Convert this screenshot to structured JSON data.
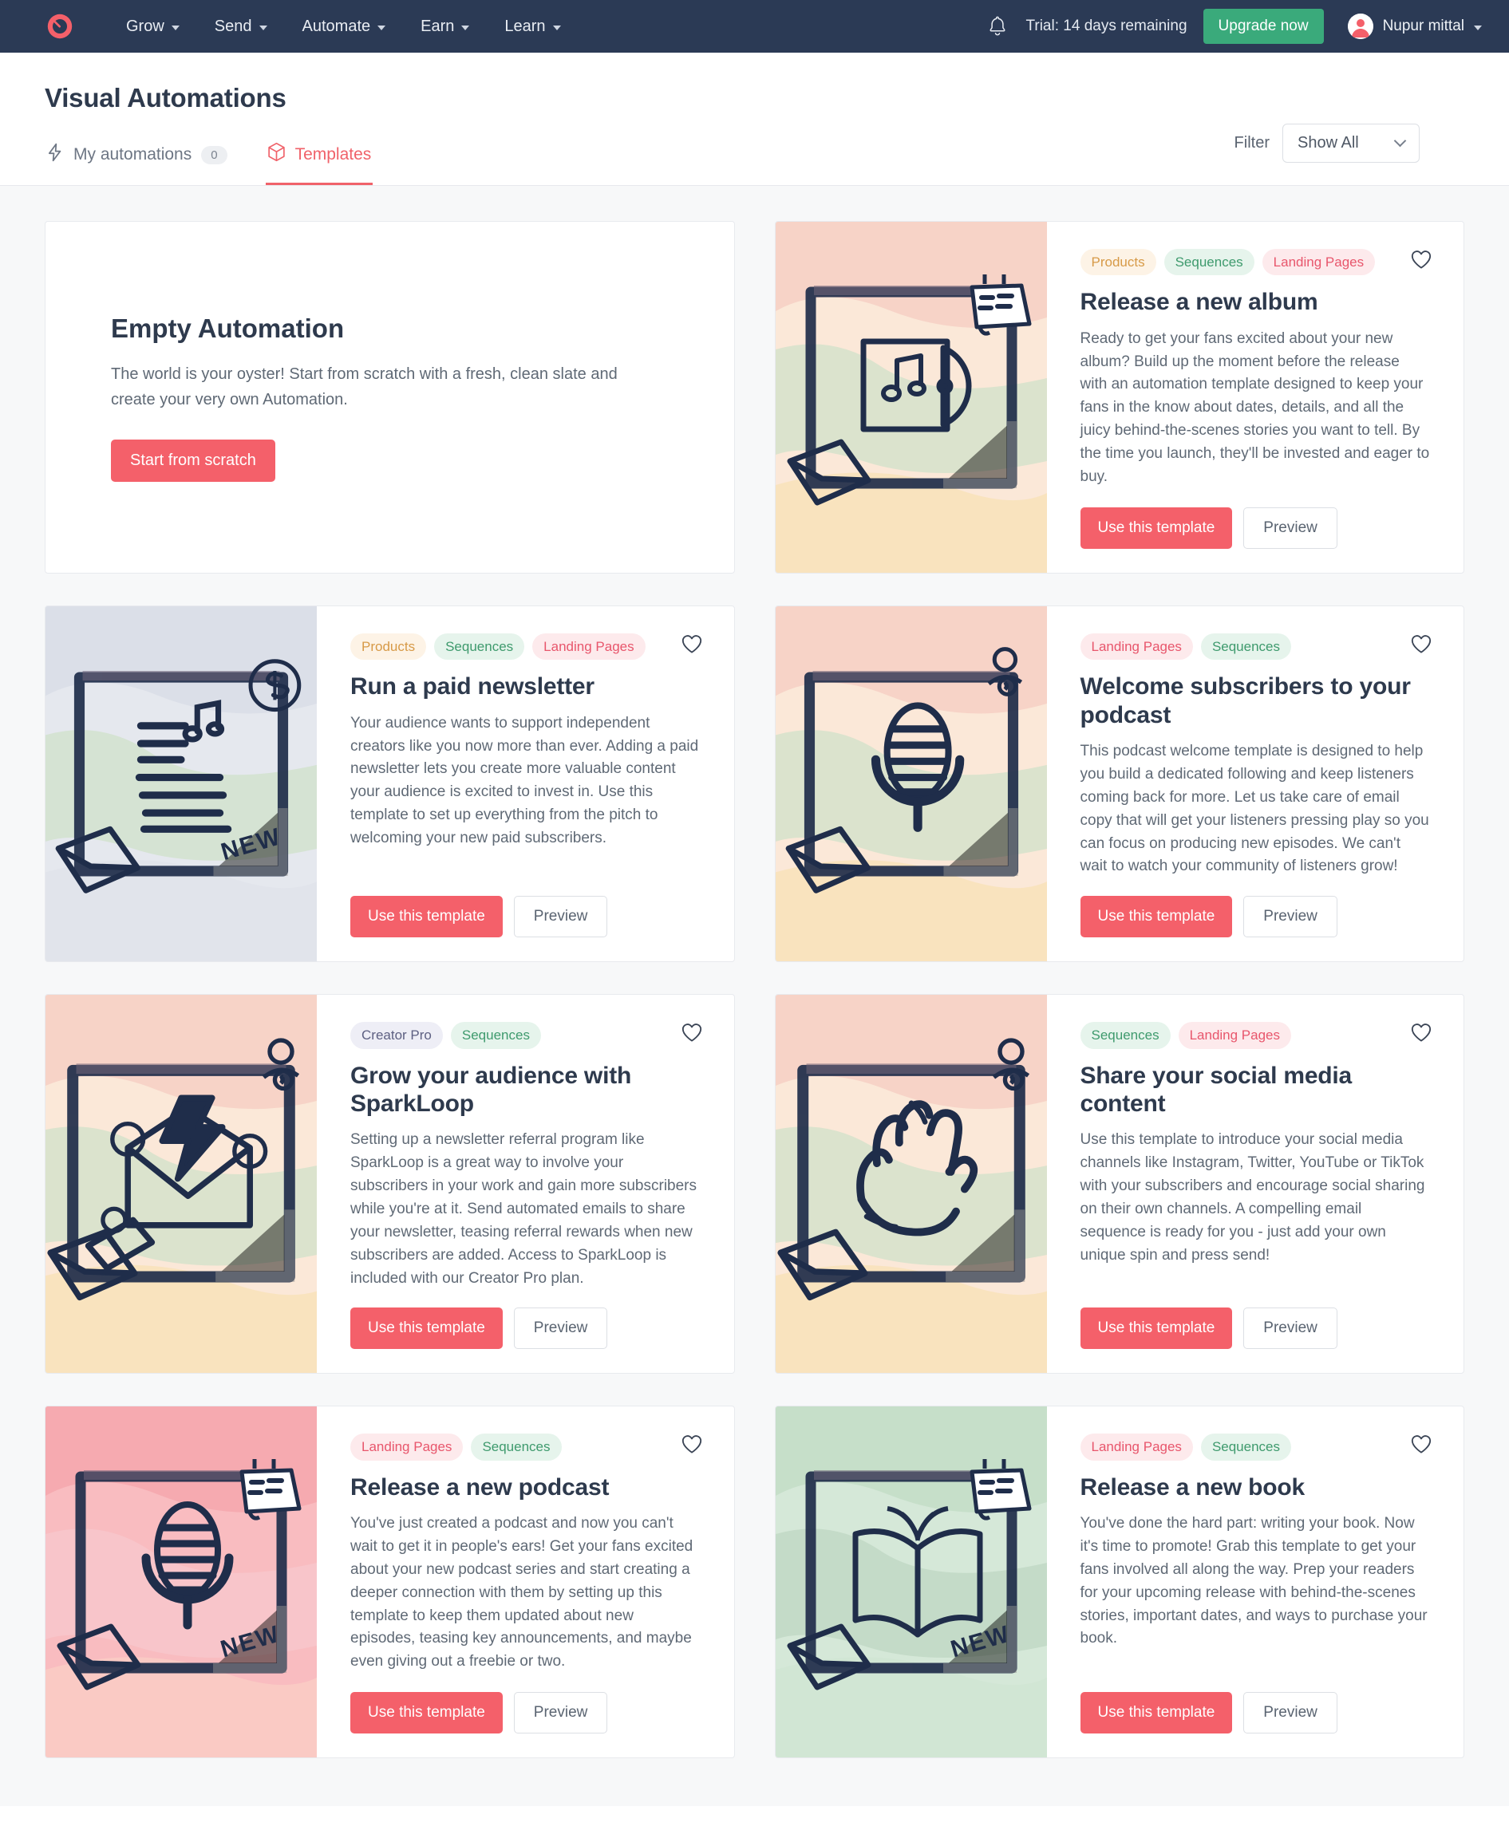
{
  "topnav": {
    "logo_icon": "convertkit-logo-icon",
    "items": [
      {
        "label": "Grow"
      },
      {
        "label": "Send"
      },
      {
        "label": "Automate"
      },
      {
        "label": "Earn"
      },
      {
        "label": "Learn"
      }
    ],
    "bell_icon": "notification-bell-icon",
    "trial_text": "Trial: 14 days remaining",
    "upgrade_label": "Upgrade now",
    "user_name": "Nupur mittal",
    "accent_green": "#3aaa7b",
    "bar_color": "#2b3a55",
    "brand_red": "#f4606a"
  },
  "page": {
    "title": "Visual Automations",
    "tabs": [
      {
        "label": "My automations",
        "badge": "0",
        "icon": "lightning-bolt-icon",
        "active": false
      },
      {
        "label": "Templates",
        "badge": "",
        "icon": "cube-icon",
        "active": true
      }
    ],
    "filter": {
      "label": "Filter",
      "value": "Show All",
      "chevron_icon": "chevron-down-icon"
    }
  },
  "empty_card": {
    "title": "Empty Automation",
    "description": "The world is your oyster! Start from scratch with a fresh, clean slate and create your very own Automation.",
    "button_label": "Start from scratch"
  },
  "buttons": {
    "use_template": "Use this template",
    "preview": "Preview",
    "favorite_icon": "heart-outline-icon"
  },
  "templates": [
    {
      "id": "release-a-new-album",
      "tags": [
        {
          "label": "Products",
          "style": "tag-products"
        },
        {
          "label": "Sequences",
          "style": "tag-sequences"
        },
        {
          "label": "Landing Pages",
          "style": "tag-landing"
        }
      ],
      "title": "Release a new album",
      "description": "Ready to get your fans excited about your new album? Build up the moment before the release with an automation template designed to keep your fans in the know about dates, details, and all the juicy behind-the-scenes stories you want to tell. By the time you launch, they'll be invested and eager to buy.",
      "thumb": {
        "icon": "album-cd-icon",
        "bg": "#fbe8d8",
        "blob1": "#f6cfc4",
        "blob2": "#cfe0c9",
        "blob3": "#f8dfae",
        "corner": "calendar",
        "badge": ""
      }
    },
    {
      "id": "run-a-paid-newsletter",
      "tags": [
        {
          "label": "Products",
          "style": "tag-products"
        },
        {
          "label": "Sequences",
          "style": "tag-sequences"
        },
        {
          "label": "Landing Pages",
          "style": "tag-landing"
        }
      ],
      "title": "Run a paid newsletter",
      "description": "Your audience wants to support independent creators like you now more than ever. Adding a paid newsletter lets you create more valuable content your audience is excited to invest in. Use this template to set up everything from the pitch to welcoming your new paid subscribers.",
      "thumb": {
        "icon": "newsletter-money-icon",
        "bg": "#e5e8ee",
        "blob1": "#d9dde6",
        "blob2": "#cfe0c9",
        "blob3": "#dde1e9",
        "corner": "dollar",
        "badge": "NEW"
      }
    },
    {
      "id": "welcome-subscribers-to-your-podcast",
      "tags": [
        {
          "label": "Landing Pages",
          "style": "tag-landing"
        },
        {
          "label": "Sequences",
          "style": "tag-sequences"
        }
      ],
      "title": "Welcome subscribers to your podcast",
      "description": "This podcast welcome template is designed to help you build a dedicated following and keep listeners coming back for more. Let us take care of email copy that will get your listeners pressing play so you can focus on producing new episodes. We can't wait to watch your community of listeners grow!",
      "thumb": {
        "icon": "microphone-icon",
        "bg": "#fbe8d8",
        "blob1": "#f6cfc4",
        "blob2": "#cfe0c9",
        "blob3": "#f8dfae",
        "corner": "person",
        "badge": ""
      }
    },
    {
      "id": "grow-your-audience-with-sparkloop",
      "tags": [
        {
          "label": "Creator Pro",
          "style": "tag-creator"
        },
        {
          "label": "Sequences",
          "style": "tag-sequences"
        }
      ],
      "title": "Grow your audience with SparkLoop",
      "description": "Setting up a newsletter referral program like SparkLoop is a great way to involve your subscribers in your work and gain more subscribers while you're at it. Send automated emails to share your newsletter, teasing referral rewards when new subscribers are added. Access to SparkLoop is included with our Creator Pro plan.",
      "thumb": {
        "icon": "envelope-bolt-icon",
        "bg": "#fbe8d8",
        "blob1": "#f6cfc4",
        "blob2": "#cfe0c9",
        "blob3": "#f8dfae",
        "corner": "person",
        "badge": ""
      }
    },
    {
      "id": "share-your-social-media-content",
      "tags": [
        {
          "label": "Sequences",
          "style": "tag-sequences"
        },
        {
          "label": "Landing Pages",
          "style": "tag-landing"
        }
      ],
      "title": "Share your social media content",
      "description": "Use this template to introduce your social media channels like Instagram, Twitter, YouTube or TikTok with your subscribers and encourage social sharing on their own channels. A compelling email sequence is ready for you - just add your own unique spin and press send!",
      "thumb": {
        "icon": "waving-hand-icon",
        "bg": "#fbe8d8",
        "blob1": "#f6cfc4",
        "blob2": "#cfe0c9",
        "blob3": "#f8dfae",
        "corner": "person",
        "badge": ""
      }
    },
    {
      "id": "release-a-new-podcast",
      "tags": [
        {
          "label": "Landing Pages",
          "style": "tag-landing"
        },
        {
          "label": "Sequences",
          "style": "tag-sequences"
        }
      ],
      "title": "Release a new podcast",
      "description": "You've just created a podcast and now you can't wait to get it in people's ears! Get your fans excited about your new podcast series and start creating a deeper connection with them by setting up this template to keep them updated about new episodes, teasing key announcements, and maybe even giving out a freebie or two.",
      "thumb": {
        "icon": "microphone-icon",
        "bg": "#f9bcc0",
        "blob1": "#f6a7ad",
        "blob2": "#f7c9cd",
        "blob3": "#fad3c6",
        "corner": "calendar",
        "badge": "NEW"
      }
    },
    {
      "id": "release-a-new-book",
      "tags": [
        {
          "label": "Landing Pages",
          "style": "tag-landing"
        },
        {
          "label": "Sequences",
          "style": "tag-sequences"
        }
      ],
      "title": "Release a new book",
      "description": "You've done the hard part: writing your book. Now it's time to promote! Grab this template to get your fans involved all along the way. Prep your readers for your upcoming release with behind-the-scenes stories, important dates, and ways to purchase your book.",
      "thumb": {
        "icon": "open-book-icon",
        "bg": "#d5e8d8",
        "blob1": "#c3ddc7",
        "blob2": "#bed6c2",
        "blob3": "#cfe4d2",
        "corner": "calendar",
        "badge": "NEW"
      }
    }
  ]
}
